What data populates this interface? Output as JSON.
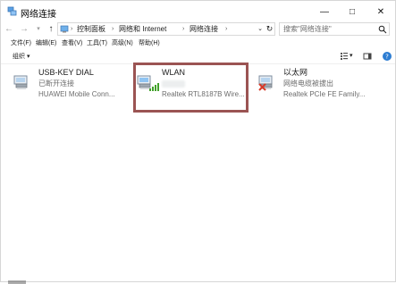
{
  "window": {
    "title": "网络连接",
    "minimize_label": "—",
    "maximize_label": "□",
    "close_label": "✕"
  },
  "navigation": {
    "back_label": "←",
    "forward_label": "→",
    "recent_label": "▾",
    "up_label": "↑"
  },
  "address": {
    "breadcrumbs": [
      "控制面板",
      "网络和 Internet",
      "网络连接"
    ],
    "separator": "›",
    "dropdown_label": "⌄",
    "refresh_label": "↻"
  },
  "search": {
    "placeholder": "搜索\"网络连接\""
  },
  "menu": {
    "items": [
      "文件(F)",
      "编辑(E)",
      "查看(V)",
      "工具(T)",
      "高级(N)",
      "帮助(H)"
    ]
  },
  "commandbar": {
    "organize_label": "组织 ▾"
  },
  "adapters": [
    {
      "name": "USB-KEY DIAL",
      "status": "已断开连接",
      "device": "HUAWEI Mobile Conn..."
    },
    {
      "name": "WLAN",
      "status": "",
      "device": "Realtek RTL8187B Wire..."
    },
    {
      "name": "以太网",
      "status": "网络电缆被拔出",
      "device": "Realtek PCIe FE Family..."
    }
  ],
  "colors": {
    "highlight": "#9b5453",
    "window_border": "#d6d6d6",
    "icon_blue": "#4d93d9",
    "error_red": "#d83b2a"
  },
  "icons": {
    "title": "network-connections-icon",
    "search": "search-icon",
    "help": "help-icon",
    "adapter": "network-adapter-icon",
    "wifi": "wifi-signal-icon",
    "disconnected": "disconnected-x-icon"
  }
}
